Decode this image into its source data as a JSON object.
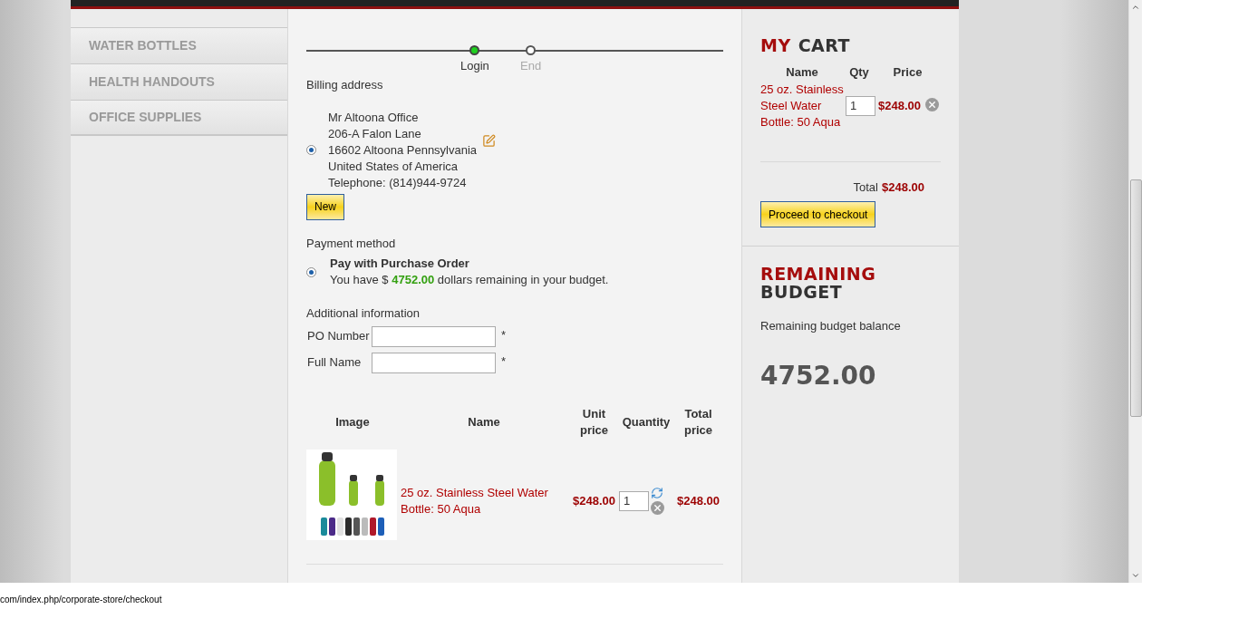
{
  "sidebar": {
    "items": [
      {
        "label": "WATER BOTTLES"
      },
      {
        "label": "HEALTH HANDOUTS"
      },
      {
        "label": "OFFICE SUPPLIES"
      }
    ]
  },
  "steps": [
    {
      "label": "Login",
      "selected": true
    },
    {
      "label": "End",
      "selected": false
    }
  ],
  "billing": {
    "title": "Billing address",
    "selected": true,
    "address_lines": [
      "Mr Altoona Office",
      "206-A Falon Lane",
      "16602 Altoona Pennsylvania",
      "United States of America",
      "Telephone: (814)944-9724"
    ],
    "new_button": "New"
  },
  "payment": {
    "title": "Payment method",
    "method": {
      "name": "Pay with Purchase Order",
      "selected": true,
      "note_prefix": "You have $",
      "amount": "4752.00",
      "note_suffix": "dollars remaining in your budget."
    }
  },
  "additional_info": {
    "title": "Additional information",
    "fields": [
      {
        "label": "PO Number",
        "required_mark": "*"
      },
      {
        "label": "Full Name",
        "required_mark": "*"
      }
    ]
  },
  "cart_table": {
    "columns": [
      "Image",
      "Name",
      "Unit price",
      "Quantity",
      "Total price"
    ],
    "rows": [
      {
        "name": "25 oz. Stainless Steel Water Bottle: 50 Aqua",
        "unit_price": "$248.00",
        "quantity": "1",
        "total": "$248.00"
      }
    ]
  },
  "my_cart": {
    "title_parts": [
      "MY",
      "CART"
    ],
    "columns": [
      "Name",
      "Qty",
      "Price"
    ],
    "items": [
      {
        "name": "25 oz. Stainless Steel Water Bottle: 50 Aqua",
        "quantity": "1",
        "price": "$248.00"
      }
    ],
    "total_label": "Total",
    "total": "$248.00",
    "checkout_button": "Proceed to checkout"
  },
  "budget": {
    "title_parts": [
      "REMAINING",
      "BUDGET"
    ],
    "label": "Remaining budget balance",
    "amount": "4752.00"
  },
  "status_bar": {
    "url": "com/index.php/corporate-store/checkout"
  }
}
